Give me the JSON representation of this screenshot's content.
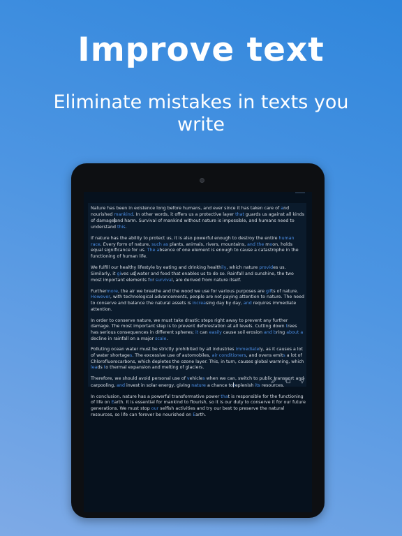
{
  "promo": {
    "headline": "Improve text",
    "subhead": "Eliminate mistakes in texts you write"
  },
  "colors": {
    "background_top": "#2f86dc",
    "background_bottom": "#7eaae6",
    "device_bezel": "#0d0f12",
    "screen_bg": "#06111d",
    "card_bg": "#0b1b2c",
    "text": "#d9dee5",
    "highlight": "#4d8fe6"
  },
  "editor": {
    "paragraphs": [
      [
        {
          "t": "Nature has been in existence long before humans, and ever since it has taken care of "
        },
        {
          "t": "a",
          "h": true
        },
        {
          "t": "nd nourished "
        },
        {
          "t": "mankind",
          "h": true
        },
        {
          "t": ". In other words, it offers us a protective layer "
        },
        {
          "t": "that",
          "h": true
        },
        {
          "t": " guards us against all kinds of damage"
        },
        {
          "c": true
        },
        {
          "t": "and harm. Survival of mankind without nature is impossible, and humans need to understand "
        },
        {
          "t": "this",
          "h": true
        },
        {
          "t": "."
        }
      ],
      [
        {
          "t": "If nature has the ability to protect us, it is also powerful enough to destroy the entire "
        },
        {
          "t": "human race",
          "h": true
        },
        {
          "t": ". Every form of nature, "
        },
        {
          "t": "such as",
          "h": true
        },
        {
          "t": " plants, animals, rivers, mountains, "
        },
        {
          "t": "and",
          "h": true
        },
        {
          "t": " "
        },
        {
          "t": "the",
          "h": true
        },
        {
          "t": " m"
        },
        {
          "t": "o",
          "h": true
        },
        {
          "t": "on, holds equal significance for us. "
        },
        {
          "t": "The",
          "h": true
        },
        {
          "t": " "
        },
        {
          "t": "a",
          "h": true
        },
        {
          "t": "bsence of one element is enough to cause a catastrophe in the functioning of human life."
        }
      ],
      [
        {
          "t": "We fulfill our healthy lifestyle by eating and drinking health"
        },
        {
          "t": "ily",
          "h": true
        },
        {
          "t": ", which nature "
        },
        {
          "t": "provid",
          "h": true
        },
        {
          "t": "es us. Similarly, it "
        },
        {
          "t": "gi",
          "h": true
        },
        {
          "t": "ves us"
        },
        {
          "c": true
        },
        {
          "t": " water and food that enables us to do so. Rainfall and sunshine, the two most important elements f"
        },
        {
          "t": "o",
          "h": true
        },
        {
          "t": "r "
        },
        {
          "t": "surviva",
          "h": true
        },
        {
          "t": "l, are derived from nature itself."
        }
      ],
      [
        {
          "t": "Further"
        },
        {
          "t": "more",
          "h": true
        },
        {
          "t": ", the air we breathe and the wood we use for various purposes are "
        },
        {
          "t": "gif",
          "h": true
        },
        {
          "t": "ts of nature. "
        },
        {
          "t": "However",
          "h": true
        },
        {
          "t": ", with technological advancements, people are not paying attention to nature. The need to conserve and balance the natural assets is "
        },
        {
          "t": "increa",
          "h": true
        },
        {
          "t": "sing day by day, "
        },
        {
          "t": "and",
          "h": true
        },
        {
          "t": " requires immediate attention."
        }
      ],
      [
        {
          "t": "In order to conserve nature, we must take drastic steps right away to prevent any further damage. The most important step is to prevent deforestation at all levels. Cutting down "
        },
        {
          "t": "t",
          "h": true
        },
        {
          "t": "rees has serious consequences in different spheres; "
        },
        {
          "t": "it",
          "h": true
        },
        {
          "t": " can "
        },
        {
          "t": "easily",
          "h": true
        },
        {
          "t": " cause soil erosion "
        },
        {
          "t": "and",
          "h": true
        },
        {
          "t": " "
        },
        {
          "t": "b",
          "h": true
        },
        {
          "t": "ring "
        },
        {
          "t": "about a",
          "h": true
        },
        {
          "t": " decline in rainfall on a major "
        },
        {
          "t": "scale",
          "h": true
        },
        {
          "t": "."
        }
      ],
      [
        {
          "t": "Polluting ocean water must be strictly prohibited by all industries "
        },
        {
          "t": "immediate",
          "h": true
        },
        {
          "t": "ly, as it causes a lot of water shortage"
        },
        {
          "t": "s",
          "h": true
        },
        {
          "t": ". The excessive use of automobiles, "
        },
        {
          "t": "air conditioners",
          "h": true
        },
        {
          "t": ", and ovens emit"
        },
        {
          "t": "s",
          "h": true
        },
        {
          "t": " a lot of Chlorofluorocarbons, which depletes the ozone layer. This, in turn, causes global warming, which "
        },
        {
          "t": "lea",
          "h": true
        },
        {
          "t": "ds "
        },
        {
          "t": "t",
          "h": true
        },
        {
          "t": "o thermal expansion and melting of glaciers."
        }
      ],
      [
        {
          "t": "Therefore, we should avoid personal use of "
        },
        {
          "t": "v",
          "h": true
        },
        {
          "t": "ehicle"
        },
        {
          "t": "s",
          "h": true
        },
        {
          "t": " when we can, switch to public transport and carpooling, "
        },
        {
          "t": "and",
          "h": true
        },
        {
          "t": " invest in solar energy, giving "
        },
        {
          "t": "nature",
          "h": true
        },
        {
          "t": " a chance to"
        },
        {
          "c": true
        },
        {
          "t": "r",
          "h": true
        },
        {
          "t": "eplenish "
        },
        {
          "t": "its",
          "h": true
        },
        {
          "t": " resources."
        }
      ],
      [
        {
          "t": "In conclusion, nature has a powerful transformative power "
        },
        {
          "t": "tha",
          "h": true
        },
        {
          "t": "t is responsible for the functioning of life on "
        },
        {
          "t": "E",
          "h": true
        },
        {
          "t": "arth. It is essential for mankind to flourish, so it is our duty to conserve it for our future generations. We must stop "
        },
        {
          "t": "our",
          "h": true
        },
        {
          "t": " selfish activities and try our best to preserve the natural resources, so life can forever be nourished on "
        },
        {
          "t": "E",
          "h": true
        },
        {
          "t": "arth."
        }
      ]
    ]
  },
  "toolbar": {
    "icons": [
      "pen-icon",
      "copy-icon",
      "send-icon"
    ]
  }
}
